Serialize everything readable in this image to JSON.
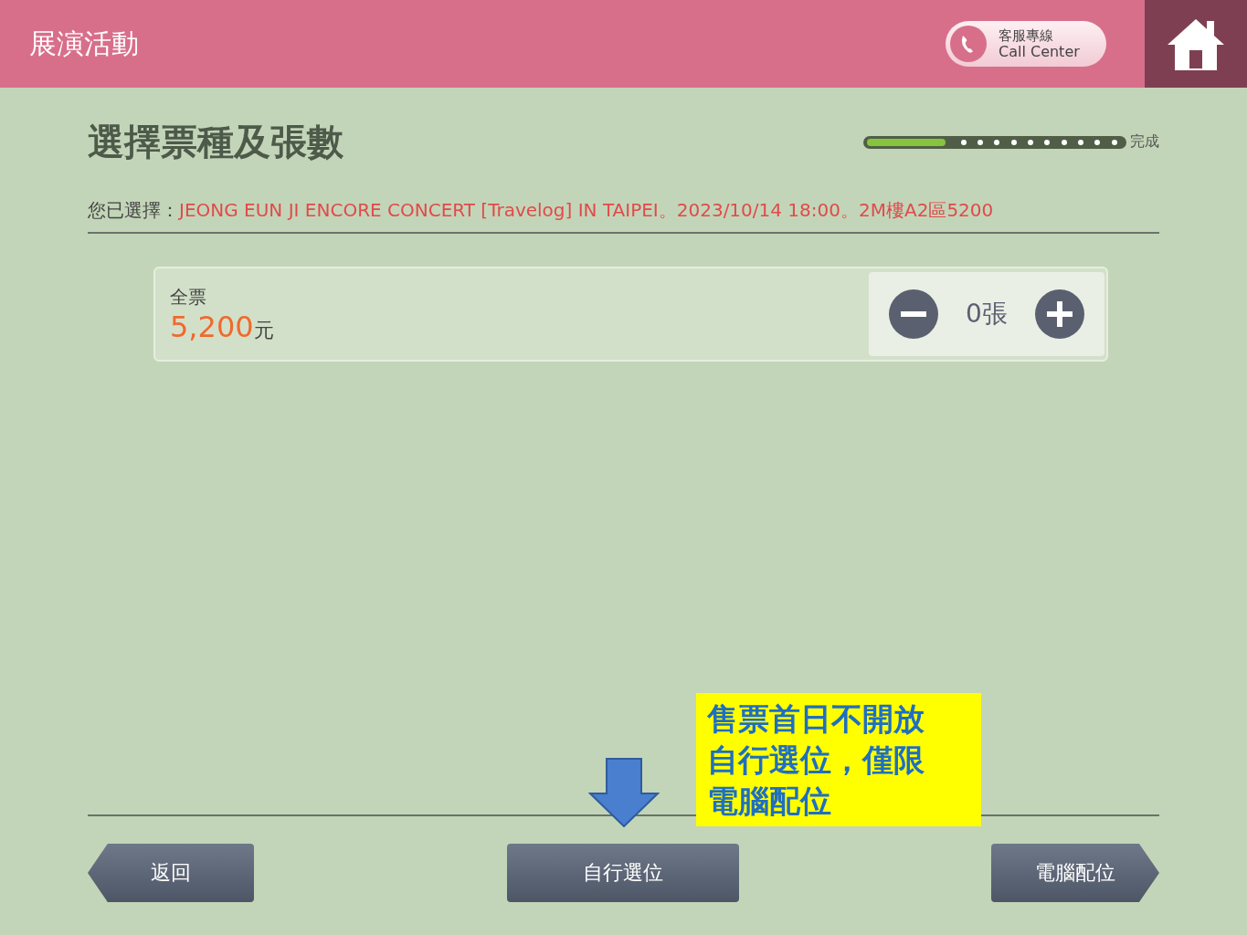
{
  "header": {
    "title": "展演活動",
    "call_center": {
      "line1": "客服專線",
      "line2": "Call Center"
    }
  },
  "page_title": "選擇票種及張數",
  "progress": {
    "level": 0.3,
    "end_label": "完成"
  },
  "selection": {
    "label": "您已選擇：",
    "value": "JEONG EUN JI ENCORE CONCERT [Travelog] IN TAIPEI。2023/10/14 18:00。2M樓A2區5200"
  },
  "tickets": [
    {
      "name": "全票",
      "price": "5,200",
      "currency": "元",
      "count": "0張"
    }
  ],
  "notice": {
    "lines": [
      "售票首日不開放",
      "自行選位，僅限",
      "電腦配位"
    ]
  },
  "buttons": [
    {
      "kind": "back",
      "label": "返回"
    },
    {
      "kind": "plain",
      "label": "自行選位"
    },
    {
      "kind": "next",
      "label": "電腦配位"
    }
  ]
}
